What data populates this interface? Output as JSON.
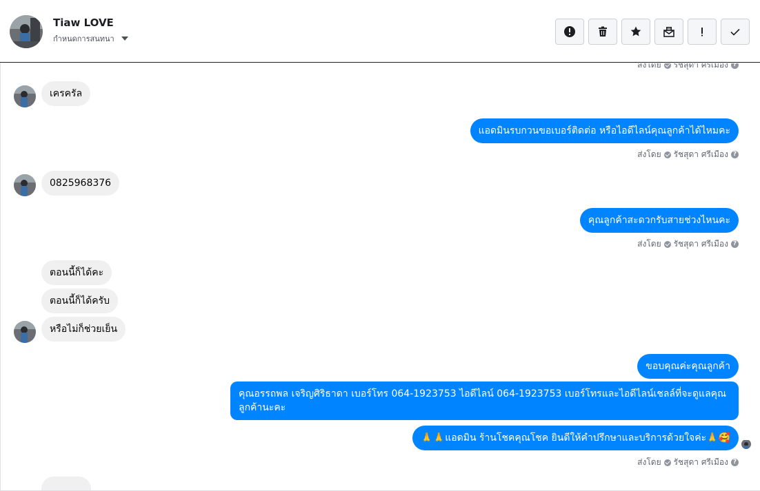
{
  "header": {
    "name": "Tiaw LOVE",
    "subtitle": "กำหนดการสนทนา"
  },
  "toolbar": {
    "buttons": [
      {
        "icon": "alert-circle-icon",
        "name": "mark-spam-button"
      },
      {
        "icon": "trash-icon",
        "name": "delete-button"
      },
      {
        "icon": "star-icon",
        "name": "star-button"
      },
      {
        "icon": "mark-unread-icon",
        "name": "mark-unread-button"
      },
      {
        "icon": "exclamation-icon",
        "name": "follow-up-button"
      },
      {
        "icon": "check-icon",
        "name": "mark-done-button"
      }
    ]
  },
  "sent_by": {
    "prefix": "ส่งโดย",
    "agent": "รัชสุดา ศรีเมือง"
  },
  "messages": [
    {
      "dir": "in",
      "text": "เครครัล"
    },
    {
      "dir": "out",
      "text": "แอดมินรบกวนขอเบอร์ติดต่อ หรือไอดีไลน์คุณลูกค้าได้ไหมคะ"
    },
    {
      "dir": "in",
      "text": "0825968376"
    },
    {
      "dir": "out",
      "text": "คุณลูกค้าสะดวกรับสายช่วงไหนคะ"
    },
    {
      "dir": "in",
      "text": "ตอนนี้ก็ได้คะ"
    },
    {
      "dir": "in",
      "text": "ตอนนี้ก็ได้ครับ"
    },
    {
      "dir": "in",
      "text": "หรือไม่ก็ช่วยเย็น"
    },
    {
      "dir": "out",
      "text": "ขอบคุณค่ะคุณลูกค้า"
    },
    {
      "dir": "out",
      "text": "คุณอรรถพล เจริญศิริธาดา      เบอร์โทร 064-1923753 ไอดีไลน์ 064-1923753   เบอร์โทรและไอดีไลน์เชลล์ที่จะดูแลคุณลูกค้านะคะ"
    },
    {
      "dir": "out",
      "text": "🙏🙏แอดมิน ร้านโชคคุณโชค ยินดีให้คำปรึกษาและบริการด้วยใจค่ะ🙏🥰"
    }
  ],
  "colors": {
    "outgoing": "#0084ff",
    "incoming": "#f0f0f0"
  }
}
